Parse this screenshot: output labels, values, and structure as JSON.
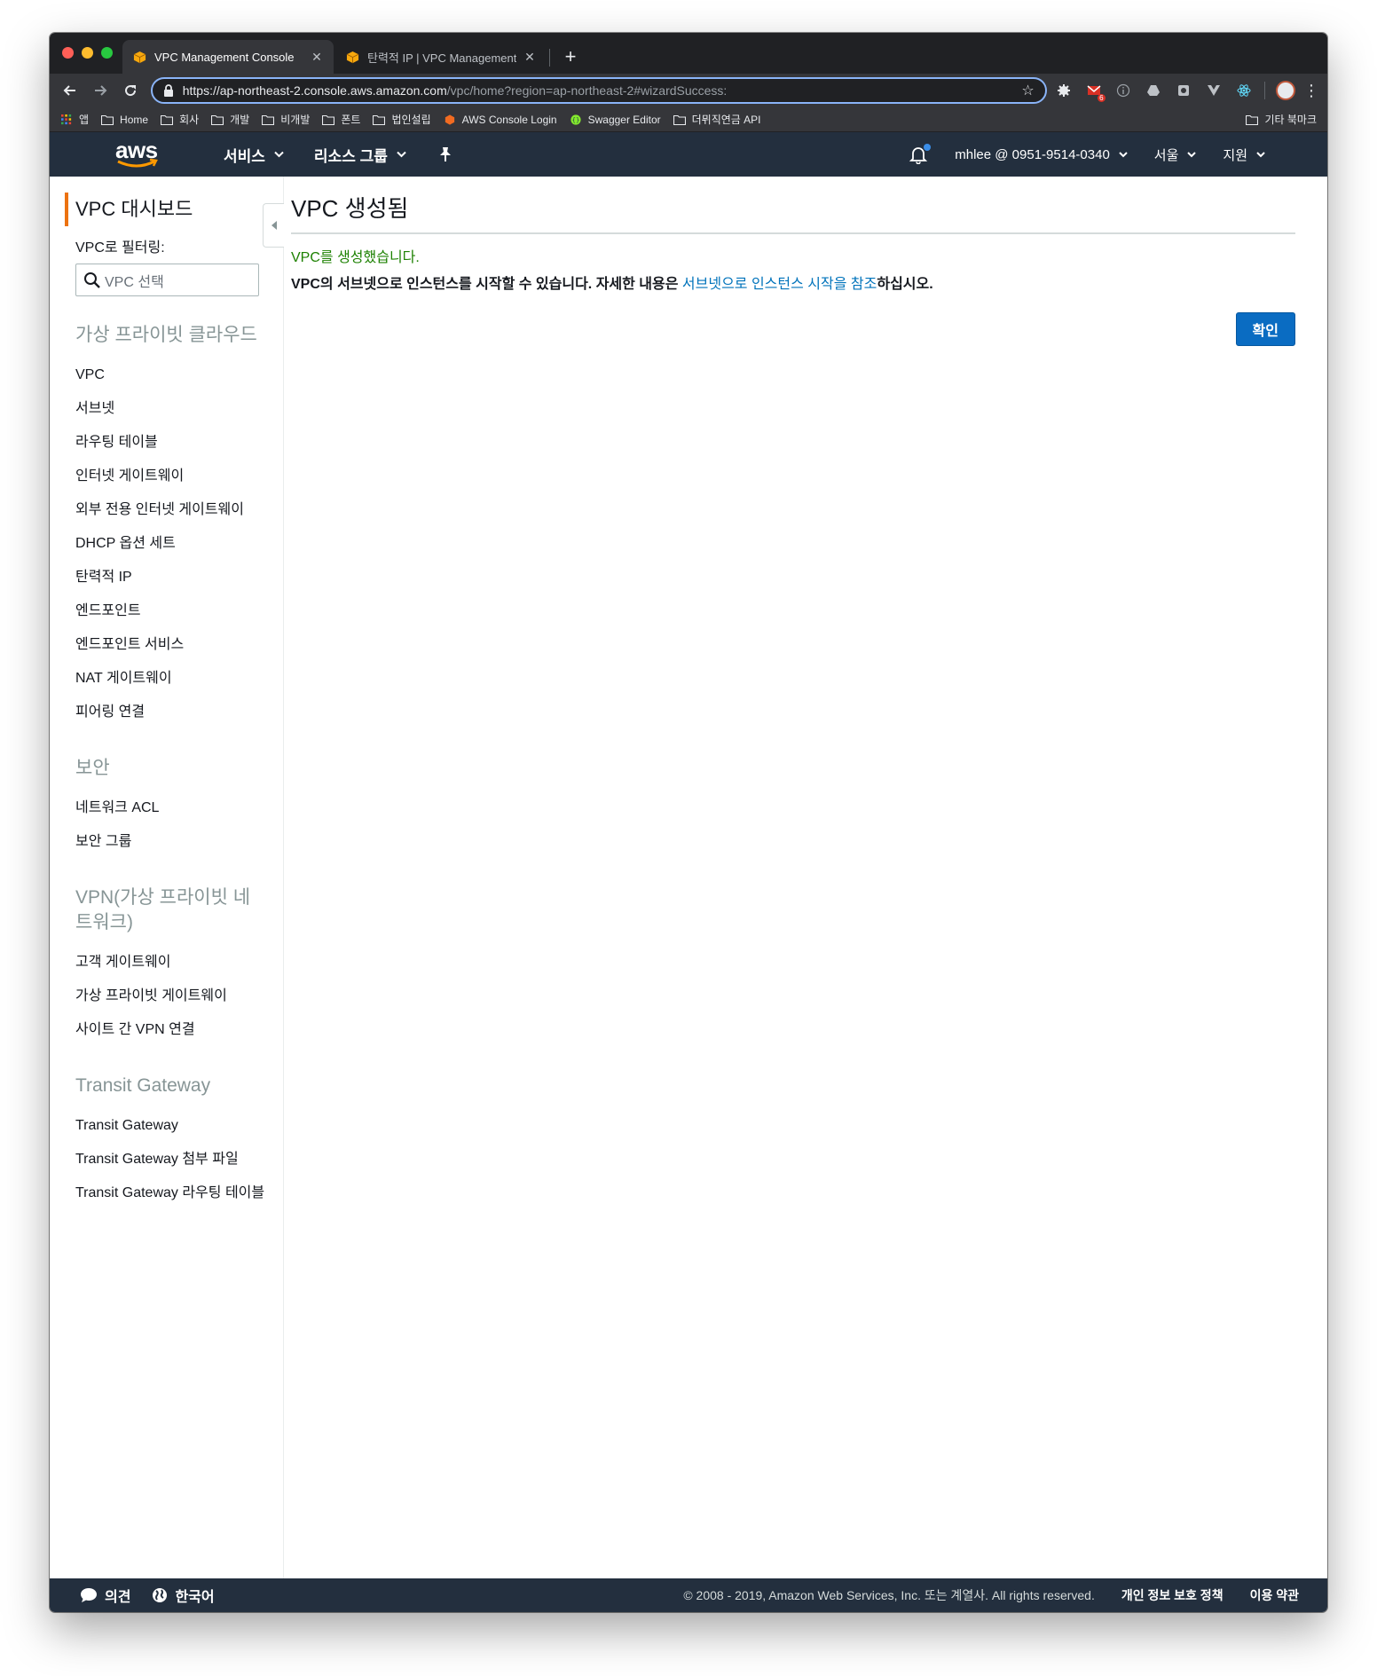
{
  "browser": {
    "tabs": [
      {
        "title": "VPC Management Console",
        "active": true
      },
      {
        "title": "탄력적 IP | VPC Management Co",
        "active": false
      }
    ],
    "url_host": "https://ap-northeast-2.console.aws.amazon.com",
    "url_path": "/vpc/home?region=ap-northeast-2#wizardSuccess:",
    "extension_badge": "6",
    "bookmarks": [
      {
        "label": "앱",
        "icon": "apps-grid-icon"
      },
      {
        "label": "Home",
        "icon": "folder-icon"
      },
      {
        "label": "회사",
        "icon": "folder-icon"
      },
      {
        "label": "개발",
        "icon": "folder-icon"
      },
      {
        "label": "비개발",
        "icon": "folder-icon"
      },
      {
        "label": "폰트",
        "icon": "folder-icon"
      },
      {
        "label": "법인설립",
        "icon": "folder-icon"
      },
      {
        "label": "AWS Console Login",
        "icon": "aws-cube-icon"
      },
      {
        "label": "Swagger Editor",
        "icon": "swagger-icon"
      },
      {
        "label": "더뮈직연금 API",
        "icon": "folder-icon"
      }
    ],
    "other_bookmarks": "기타 북마크"
  },
  "aws_nav": {
    "logo": "aws",
    "services": "서비스",
    "resource_groups": "리소스 그룹",
    "account": "mhlee @ 0951-9514-0340",
    "region": "서울",
    "support": "지원"
  },
  "sidebar": {
    "title": "VPC 대시보드",
    "filter_label": "VPC로 필터링:",
    "filter_placeholder": "VPC 선택",
    "sections": [
      {
        "heading": "가상 프라이빗 클라우드",
        "items": [
          "VPC",
          "서브넷",
          "라우팅 테이블",
          "인터넷 게이트웨이",
          "외부 전용 인터넷 게이트웨이",
          "DHCP 옵션 세트",
          "탄력적 IP",
          "엔드포인트",
          "엔드포인트 서비스",
          "NAT 게이트웨이",
          "피어링 연결"
        ]
      },
      {
        "heading": "보안",
        "items": [
          "네트워크 ACL",
          "보안 그룹"
        ]
      },
      {
        "heading": "VPN(가상 프라이빗 네트워크)",
        "items": [
          "고객 게이트웨이",
          "가상 프라이빗 게이트웨이",
          "사이트 간 VPN 연결"
        ]
      },
      {
        "heading": "Transit Gateway",
        "items": [
          "Transit Gateway",
          "Transit Gateway 첨부 파일",
          "Transit Gateway 라우팅 테이블"
        ]
      }
    ]
  },
  "main": {
    "title": "VPC 생성됨",
    "success": "VPC를 생성했습니다.",
    "info_prefix": "VPC의 서브넷으로 인스턴스를 시작할 수 있습니다. 자세한 내용은 ",
    "info_link": "서브넷으로 인스턴스 시작을 참조",
    "info_suffix": "하십시오.",
    "confirm_button": "확인"
  },
  "footer": {
    "feedback": "의견",
    "language": "한국어",
    "copyright": "© 2008 - 2019, Amazon Web Services, Inc. 또는 계열사. All rights reserved.",
    "privacy": "개인 정보 보호 정책",
    "terms": "이용 약관"
  },
  "colors": {
    "aws_nav": "#232f3e",
    "accent_orange": "#ec7211",
    "success_green": "#1d8102",
    "link_blue": "#0073bb",
    "primary_button": "#0a6cc2"
  }
}
